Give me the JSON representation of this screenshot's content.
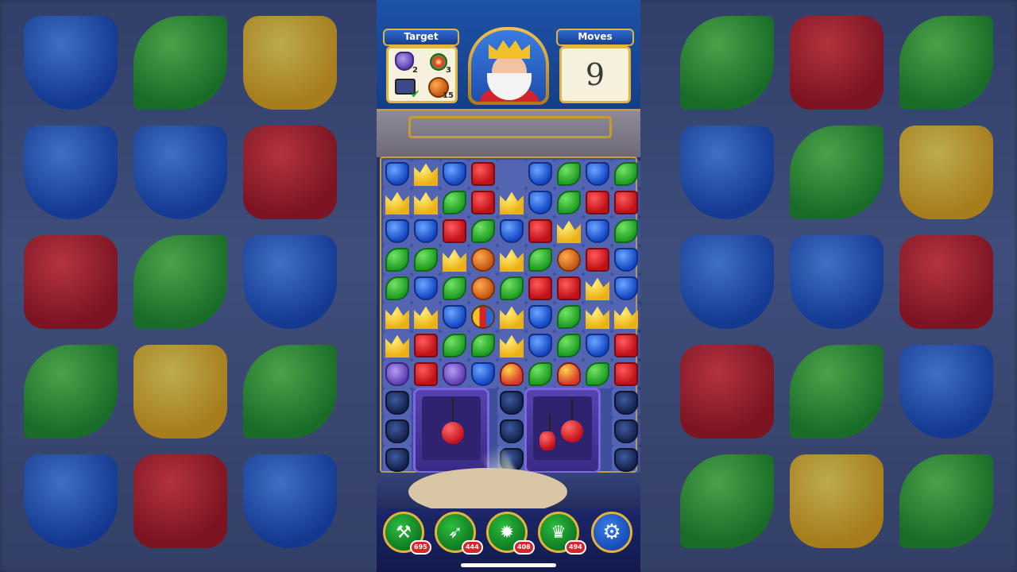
{
  "hud": {
    "target_title": "Target",
    "moves_title": "Moves",
    "moves_value": "9",
    "targets": [
      {
        "icon": "vase-icon",
        "count": "2"
      },
      {
        "icon": "potion-icon",
        "count": "3"
      },
      {
        "icon": "tv-icon",
        "count": "✔"
      },
      {
        "icon": "pumpkin-icon",
        "count": "15"
      }
    ],
    "avatar": "king-avatar"
  },
  "board": {
    "rows": [
      [
        "blue",
        "yellow",
        "blue",
        "red",
        "",
        "blue",
        "green",
        "blue",
        "green"
      ],
      [
        "yellow",
        "yellow",
        "green",
        "red",
        "yellow",
        "blue",
        "green",
        "red",
        "red"
      ],
      [
        "blue",
        "blue",
        "red",
        "green",
        "blue",
        "red",
        "yellow",
        "blue",
        "green"
      ],
      [
        "green",
        "green",
        "yellow",
        "pumpkin",
        "yellow",
        "green",
        "pumpkin",
        "red",
        "blue"
      ],
      [
        "green",
        "blue",
        "green",
        "pumpkin",
        "green",
        "red",
        "red",
        "yellow",
        "blue"
      ],
      [
        "yellow",
        "yellow",
        "blue",
        "bomb",
        "yellow",
        "blue",
        "green",
        "yellow",
        "yellow"
      ],
      [
        "yellow",
        "red",
        "green",
        "green",
        "yellow",
        "blue",
        "green",
        "blue",
        "red"
      ],
      [
        "vase",
        "red",
        "vase",
        "blue",
        "jester",
        "green",
        "jester",
        "green",
        "red"
      ],
      [
        "pot",
        "",
        "",
        "",
        "pot",
        "",
        "",
        "",
        "pot"
      ],
      [
        "pot",
        "",
        "",
        "",
        "pot",
        "",
        "",
        "",
        "pot"
      ],
      [
        "pot",
        "",
        "",
        "",
        "pot",
        "",
        "",
        "",
        "pot"
      ]
    ]
  },
  "boosters": [
    {
      "name": "hammer",
      "icon": "hammer-icon",
      "count": "695"
    },
    {
      "name": "arrow",
      "icon": "arrow-icon",
      "count": "444"
    },
    {
      "name": "cannon",
      "icon": "cannon-icon",
      "count": "408"
    },
    {
      "name": "jester",
      "icon": "jester-hat-icon",
      "count": "494"
    }
  ],
  "settings_icon": "gear-icon",
  "colors": {
    "hud_blue": "#1d52a8",
    "gold": "#e2b43c",
    "booster_green": "#2cbd3e"
  }
}
